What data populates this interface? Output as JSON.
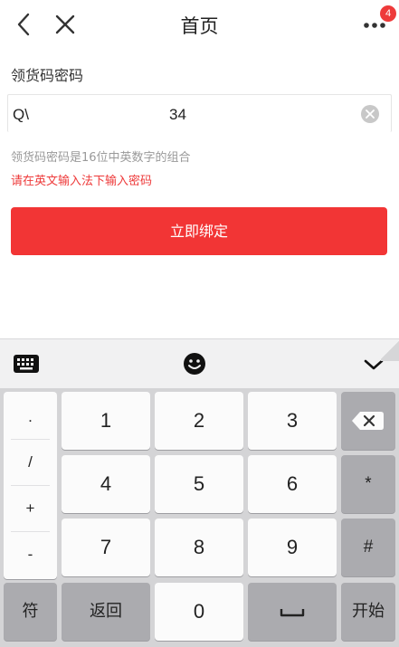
{
  "header": {
    "title": "首页",
    "badge_count": "4",
    "icons": [
      "back-icon",
      "close-icon",
      "more-icon"
    ]
  },
  "form": {
    "label": "领货码密码",
    "input_prefix": "Q\\",
    "input_value": "34",
    "hint": "领货码密码是16位中英数字的组合",
    "warning": "请在英文输入法下输入密码",
    "submit_label": "立即绑定"
  },
  "keyboard": {
    "toolbar_icons": [
      "keyboard-icon",
      "emoji-icon",
      "collapse-keyboard-icon"
    ],
    "symbols": [
      ".",
      "/",
      "+",
      "-"
    ],
    "digits": [
      "1",
      "2",
      "3",
      "4",
      "5",
      "6",
      "7",
      "8",
      "9",
      "0"
    ],
    "star": "*",
    "hash": "#",
    "fu_label": "符",
    "back_label": "返回",
    "start_label": "开始"
  },
  "colors": {
    "accent_red": "#f23535",
    "warning_red": "#ee3a3a",
    "hint_gray": "#999999",
    "keyboard_bg": "#d4d4d6",
    "dark_key": "#ababaf"
  }
}
